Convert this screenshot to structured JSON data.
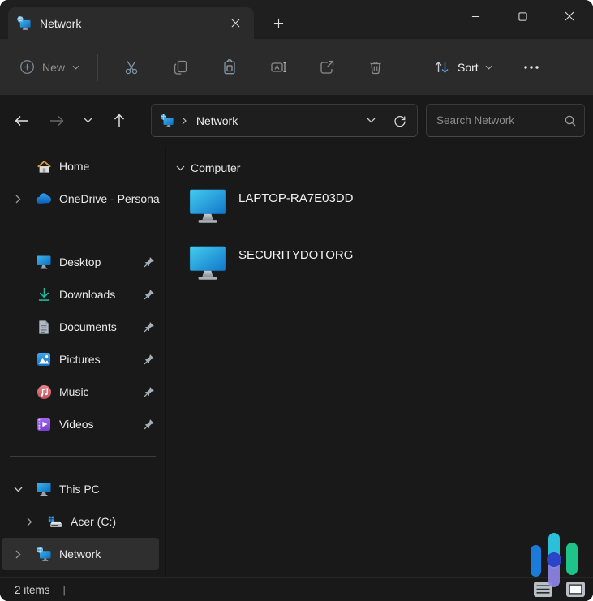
{
  "tab_bar": {
    "tab_label": "Network",
    "tab_icon": "network-icon",
    "close_icon": "close-icon",
    "new_tab_icon": "plus-icon"
  },
  "toolbar": {
    "new_label": "New",
    "sort_label": "Sort",
    "tools": [
      "cut",
      "copy",
      "paste",
      "rename",
      "share",
      "delete"
    ],
    "more_icon": "ellipsis-icon"
  },
  "navigation": {
    "breadcrumb_root": "Network",
    "search_placeholder": "Search Network",
    "search_value": ""
  },
  "sidebar": {
    "home": "Home",
    "onedrive": "OneDrive - Persona",
    "quick": [
      "Desktop",
      "Downloads",
      "Documents",
      "Pictures",
      "Music",
      "Videos"
    ],
    "this_pc": "This PC",
    "drive": "Acer (C:)",
    "network": "Network"
  },
  "content": {
    "group_label": "Computer",
    "items": [
      {
        "name": "LAPTOP-RA7E03DD",
        "icon": "computer-monitor-icon"
      },
      {
        "name": "SECURITYDOTORG",
        "icon": "computer-monitor-icon"
      }
    ]
  },
  "status_bar": {
    "items_count": "2 items",
    "separator": "|"
  },
  "colors": {
    "titlebar_bg": "#1f1f1f",
    "commandbar_bg": "#2b2b2b",
    "body_bg": "#191919",
    "selected_row_bg": "#2f2f2f",
    "accent_blue": "#4aa3e8",
    "logo_blue": "#1a7cd8",
    "logo_cyan": "#2ac0da",
    "logo_purple": "#8d84e4",
    "logo_navy": "#2b44c8",
    "logo_green": "#1dc389"
  }
}
